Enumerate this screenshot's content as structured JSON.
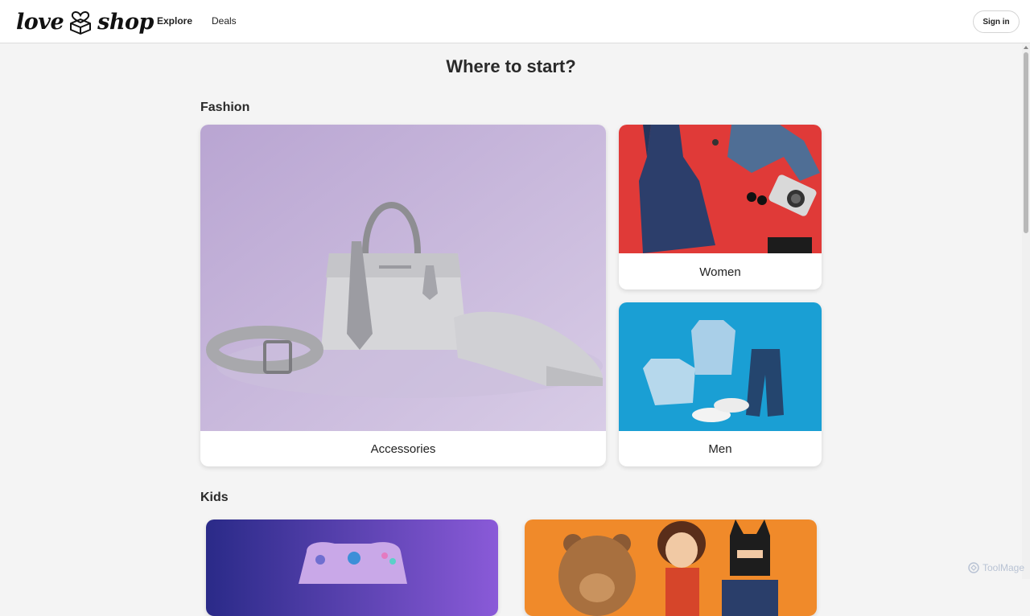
{
  "header": {
    "logo_left": "love",
    "logo_right": "shop",
    "nav": [
      {
        "label": "Explore",
        "active": true
      },
      {
        "label": "Deals",
        "active": false
      }
    ],
    "signin_label": "Sign in"
  },
  "main": {
    "title": "Where to start?",
    "sections": [
      {
        "title": "Fashion",
        "cards": [
          {
            "label": "Accessories"
          },
          {
            "label": "Women"
          },
          {
            "label": "Men"
          }
        ]
      },
      {
        "title": "Kids",
        "cards": [
          {
            "label": ""
          },
          {
            "label": ""
          }
        ]
      }
    ]
  },
  "watermark": "ToolMage",
  "colors": {
    "background": "#f4f4f4",
    "accessories_bg": "#c9b8dc",
    "women_bg": "#e03a38",
    "men_bg": "#1a9fd4",
    "gaming_bg": "#5a3fc0",
    "toys_bg": "#f08a2a"
  }
}
